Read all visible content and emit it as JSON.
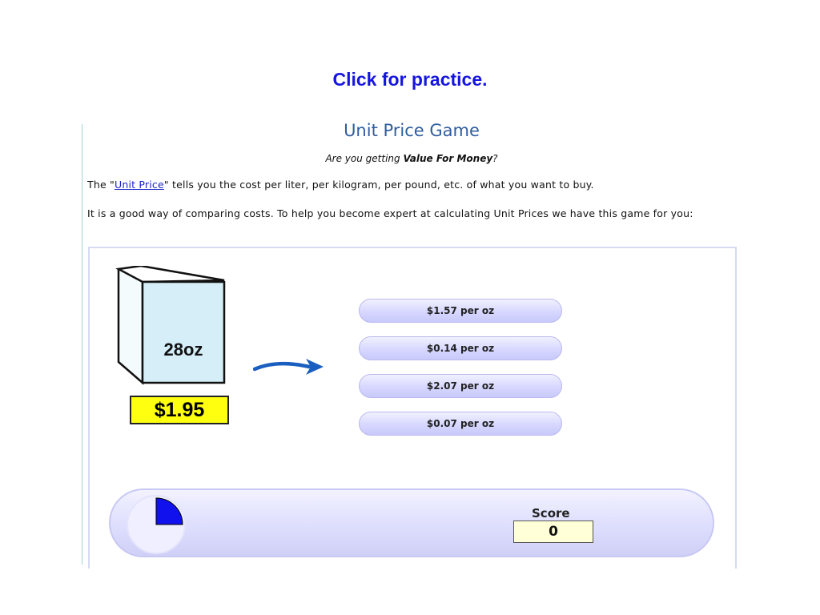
{
  "slide": {
    "link_text": "Click for practice."
  },
  "game": {
    "title": "Unit Price Game",
    "subtitle_prefix": "Are you getting ",
    "subtitle_bold": "Value For Money",
    "subtitle_suffix": "?",
    "intro_before_link": "The \"",
    "intro_link": "Unit Price",
    "intro_after_link": "\" tells you the cost per liter, per kilogram, per pound, etc. of what you want to buy.",
    "intro2": "It is a good way of comparing costs. To help you become expert at calculating Unit Prices we have this game for you:",
    "product": {
      "size_label": "28oz",
      "price": "$1.95"
    },
    "answers": [
      "$1.57 per oz",
      "$0.14 per oz",
      "$2.07 per oz",
      "$0.07 per oz"
    ],
    "score": {
      "label": "Score",
      "value": "0"
    },
    "timer": {
      "remaining_fraction": 0.25
    },
    "colors": {
      "link": "#1515e0",
      "price_tag": "#ffff10",
      "timer": "#1111ee",
      "answer": "#d7d7ff",
      "title": "#2f5e9e"
    },
    "icons": [
      "product-box-icon",
      "arrow-right-icon",
      "timer-icon"
    ]
  }
}
